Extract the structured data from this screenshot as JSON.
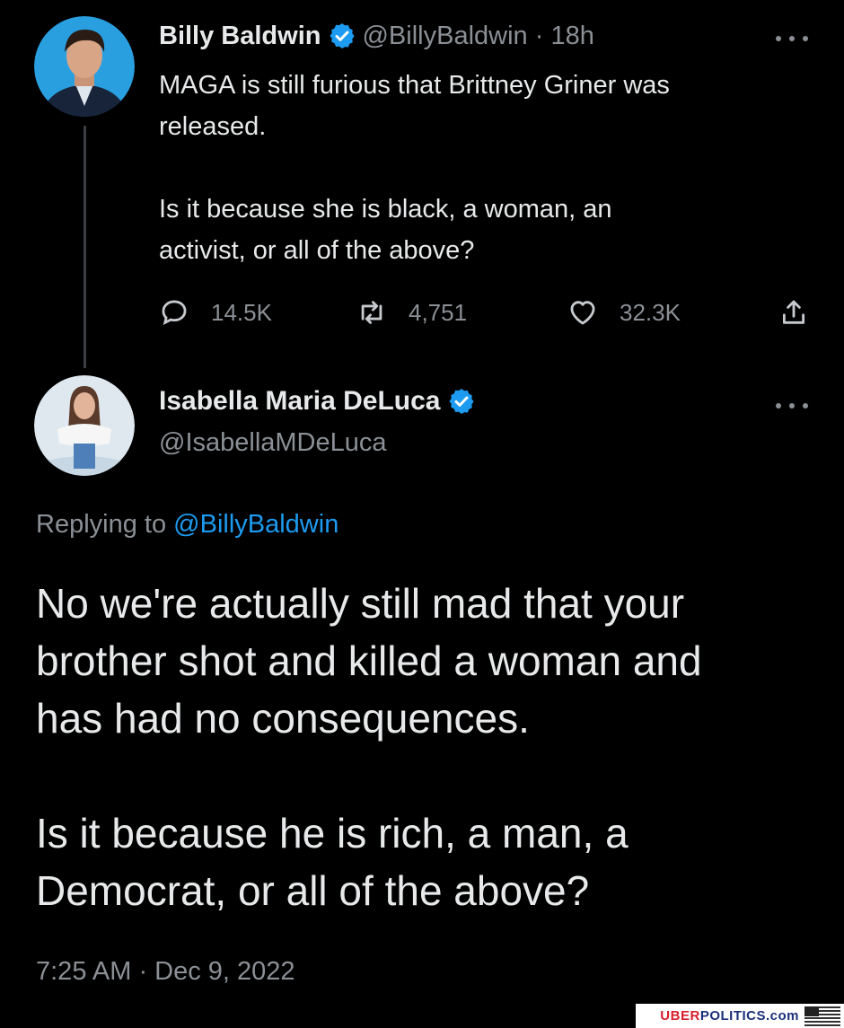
{
  "tweet": {
    "author_name": "Billy Baldwin",
    "author_handle": "@BillyBaldwin",
    "time_ago": "18h",
    "text": "MAGA is still furious that Brittney Griner was\nreleased.\n\nIs it because she is black, a woman, an\nactivist, or all of the above?",
    "stats": {
      "replies": "14.5K",
      "retweets": "4,751",
      "likes": "32.3K"
    }
  },
  "reply": {
    "author_name": "Isabella Maria DeLuca",
    "author_handle": "@IsabellaMDeLuca",
    "replying_label": "Replying to",
    "replying_to": "@BillyBaldwin",
    "text": "No we're actually still mad that your\nbrother shot and killed a woman and\nhas had no consequences.\n\nIs it because he is rich, a man, a\nDemocrat, or all of the above?",
    "timestamp": "7:25 AM · Dec 9, 2022"
  },
  "watermark": {
    "uber": "UBER",
    "politics": "POLITICS.com",
    "uber_color": "#d6202e",
    "politics_color": "#1b2f7a"
  },
  "colors": {
    "background": "#000000",
    "text": "#e7e9ea",
    "muted": "#8b9096",
    "accent": "#1d9bf0"
  },
  "icons": [
    "verified-badge-icon",
    "more-icon",
    "reply-icon",
    "retweet-icon",
    "like-icon",
    "share-icon",
    "us-flag-icon"
  ]
}
